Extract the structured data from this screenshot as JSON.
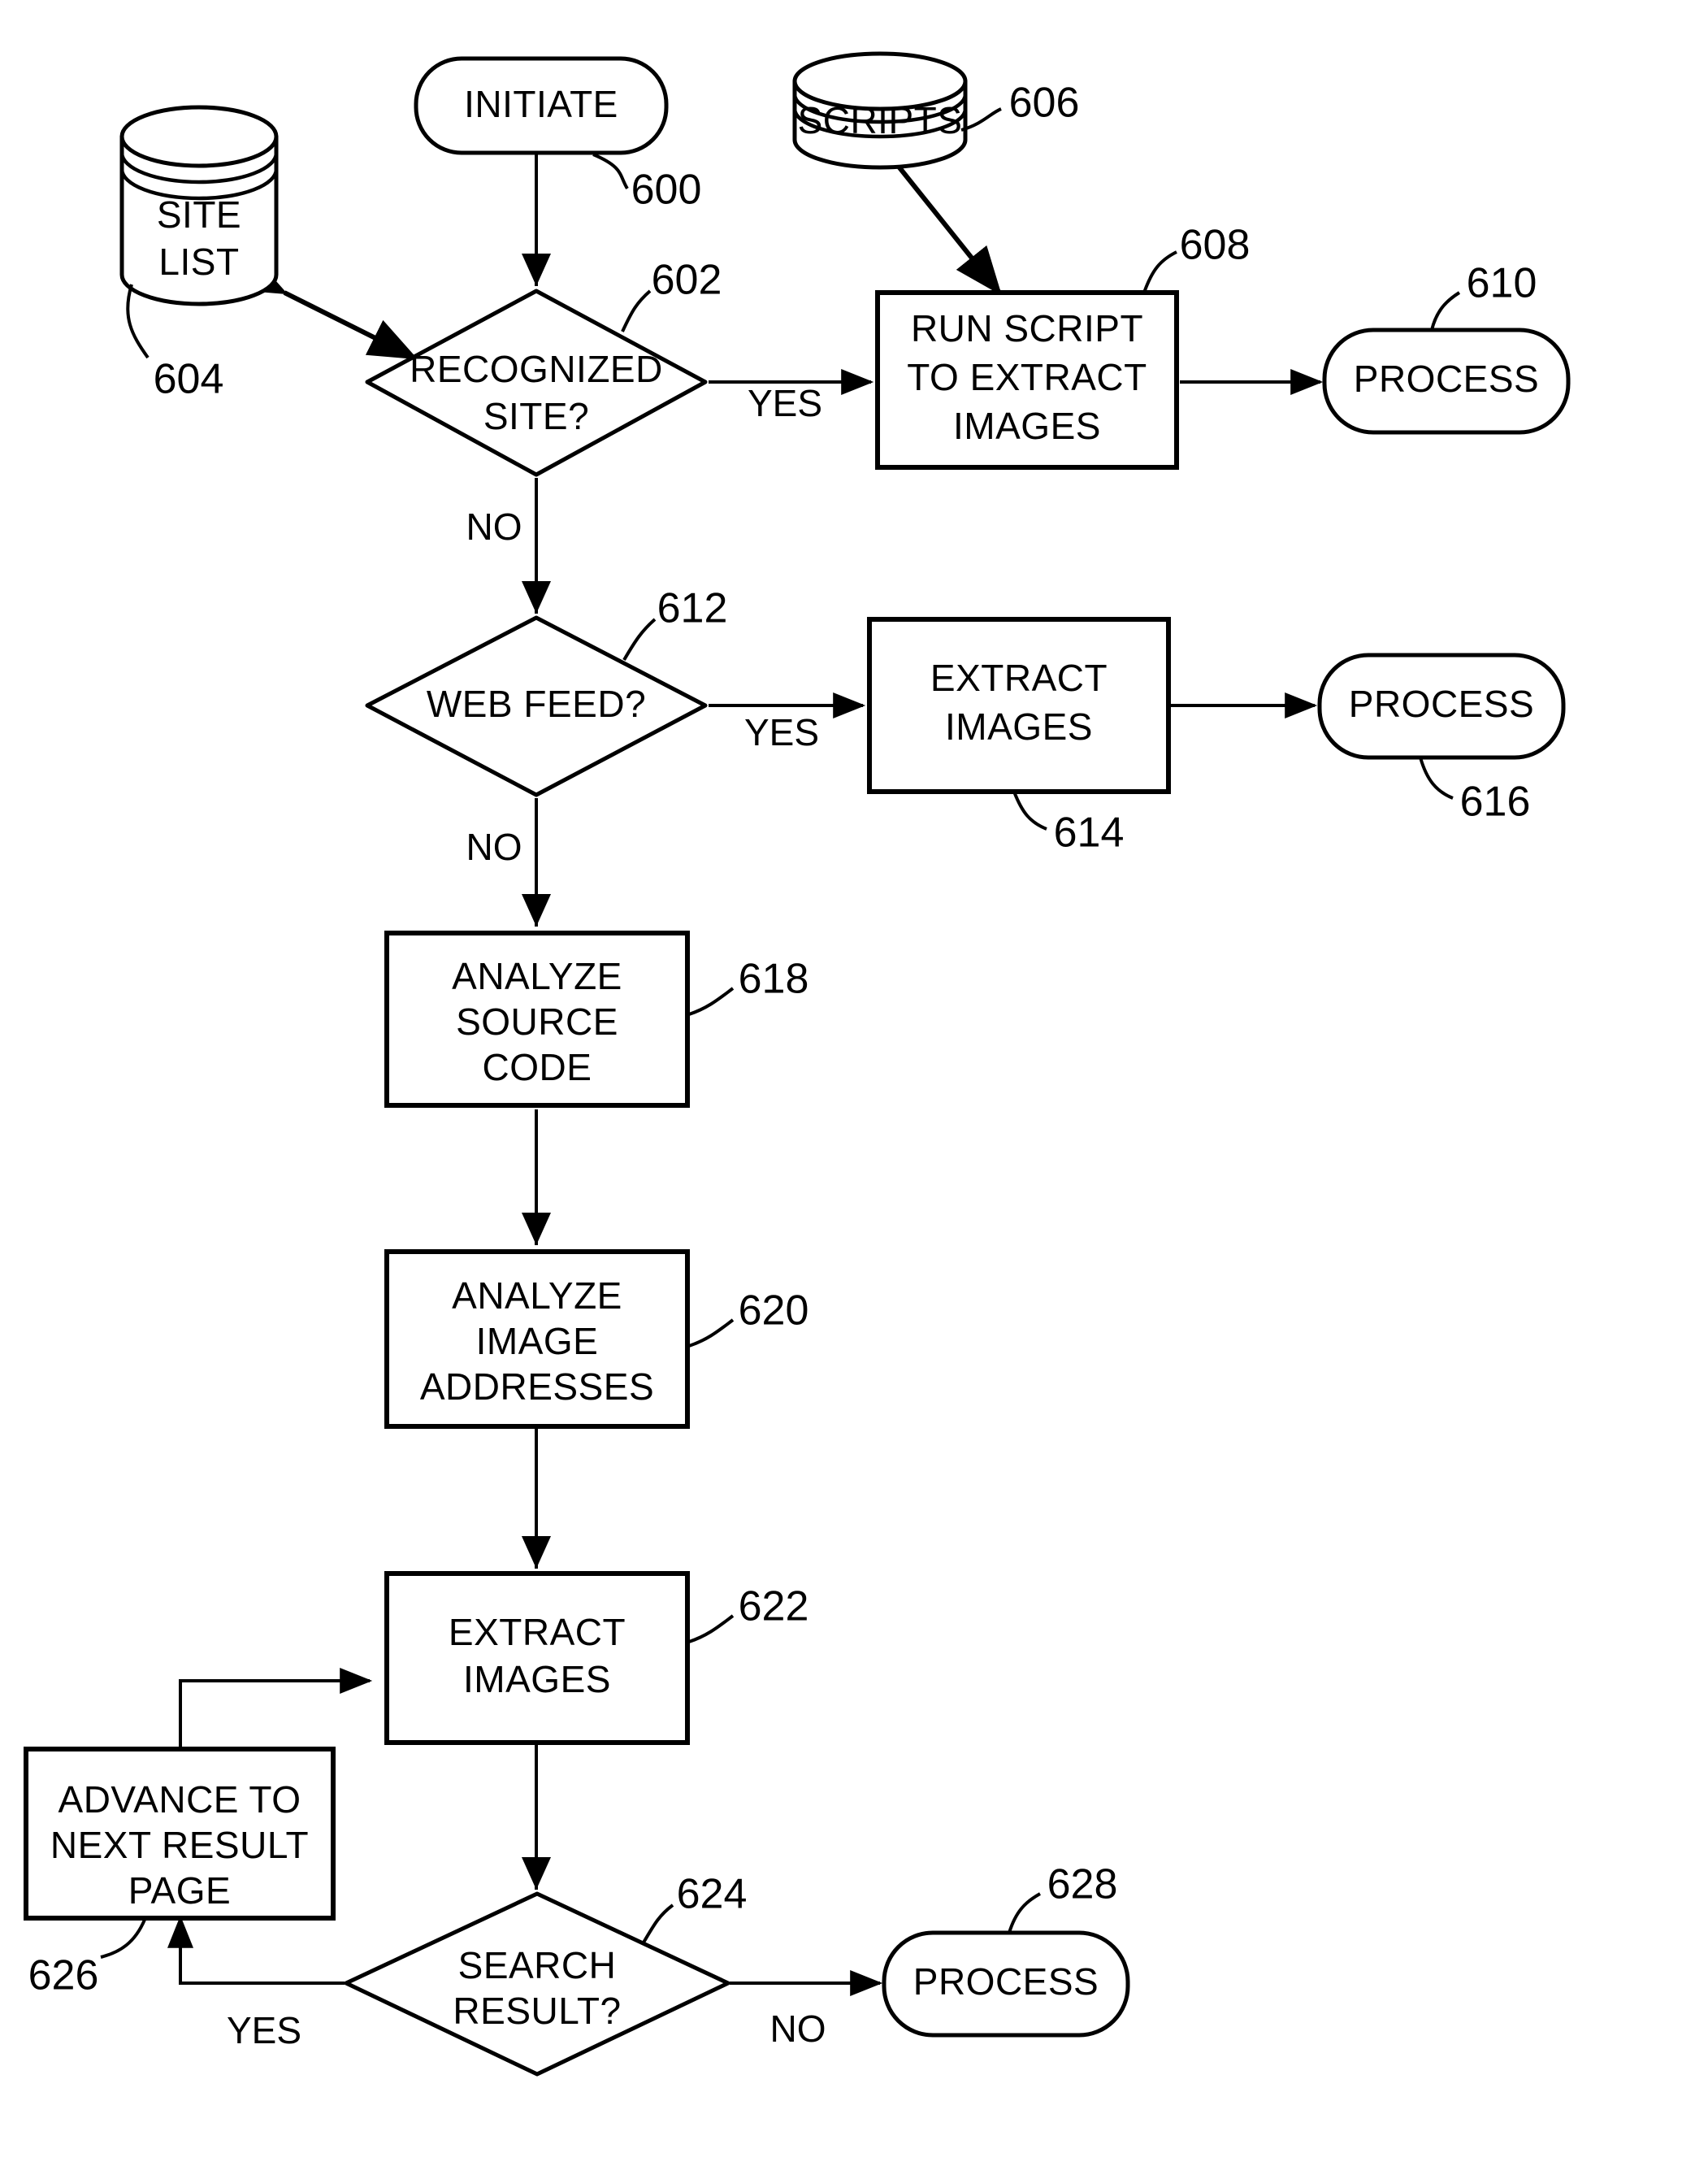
{
  "figure": {
    "type": "patent-flowchart",
    "background": "#ffffff",
    "ink": "#000000"
  },
  "nodes": {
    "initiate": {
      "label": "INITIATE",
      "shape": "rounded-terminator",
      "ref": "600"
    },
    "site_list": {
      "label_line1": "SITE",
      "label_line2": "LIST",
      "shape": "cylinder-datastore",
      "ref": "604"
    },
    "scripts": {
      "label": "SCRIPTS",
      "shape": "cylinder-datastore",
      "ref": "606"
    },
    "recognized_site": {
      "label_line1": "RECOGNIZED",
      "label_line2": "SITE?",
      "shape": "diamond-decision",
      "ref": "602"
    },
    "run_script": {
      "label_line1": "RUN SCRIPT",
      "label_line2": "TO EXTRACT",
      "label_line3": "IMAGES",
      "shape": "rectangle-process",
      "ref": "608"
    },
    "process_610": {
      "label": "PROCESS",
      "shape": "rounded-terminator",
      "ref": "610"
    },
    "web_feed": {
      "label": "WEB FEED?",
      "shape": "diamond-decision",
      "ref": "612"
    },
    "extract_images_614": {
      "label_line1": "EXTRACT",
      "label_line2": "IMAGES",
      "shape": "rectangle-process",
      "ref": "614"
    },
    "process_616": {
      "label": "PROCESS",
      "shape": "rounded-terminator",
      "ref": "616"
    },
    "analyze_source_code": {
      "label_line1": "ANALYZE",
      "label_line2": "SOURCE",
      "label_line3": "CODE",
      "shape": "rectangle-process",
      "ref": "618"
    },
    "analyze_image_addresses": {
      "label_line1": "ANALYZE",
      "label_line2": "IMAGE",
      "label_line3": "ADDRESSES",
      "shape": "rectangle-process",
      "ref": "620"
    },
    "extract_images_622": {
      "label_line1": "EXTRACT",
      "label_line2": "IMAGES",
      "shape": "rectangle-process",
      "ref": "622"
    },
    "advance_next_page": {
      "label_line1": "ADVANCE TO",
      "label_line2": "NEXT RESULT",
      "label_line3": "PAGE",
      "shape": "rectangle-process",
      "ref": "626"
    },
    "search_result": {
      "label_line1": "SEARCH",
      "label_line2": "RESULT?",
      "shape": "diamond-decision",
      "ref": "624"
    },
    "process_628": {
      "label": "PROCESS",
      "shape": "rounded-terminator",
      "ref": "628"
    }
  },
  "edge_labels": {
    "recognized_yes": "YES",
    "recognized_no": "NO",
    "webfeed_yes": "YES",
    "webfeed_no": "NO",
    "search_yes": "YES",
    "search_no": "NO"
  },
  "reference_numerals": {
    "n600": "600",
    "n602": "602",
    "n604": "604",
    "n606": "606",
    "n608": "608",
    "n610": "610",
    "n612": "612",
    "n614": "614",
    "n616": "616",
    "n618": "618",
    "n620": "620",
    "n622": "622",
    "n624": "624",
    "n626": "626",
    "n628": "628"
  }
}
